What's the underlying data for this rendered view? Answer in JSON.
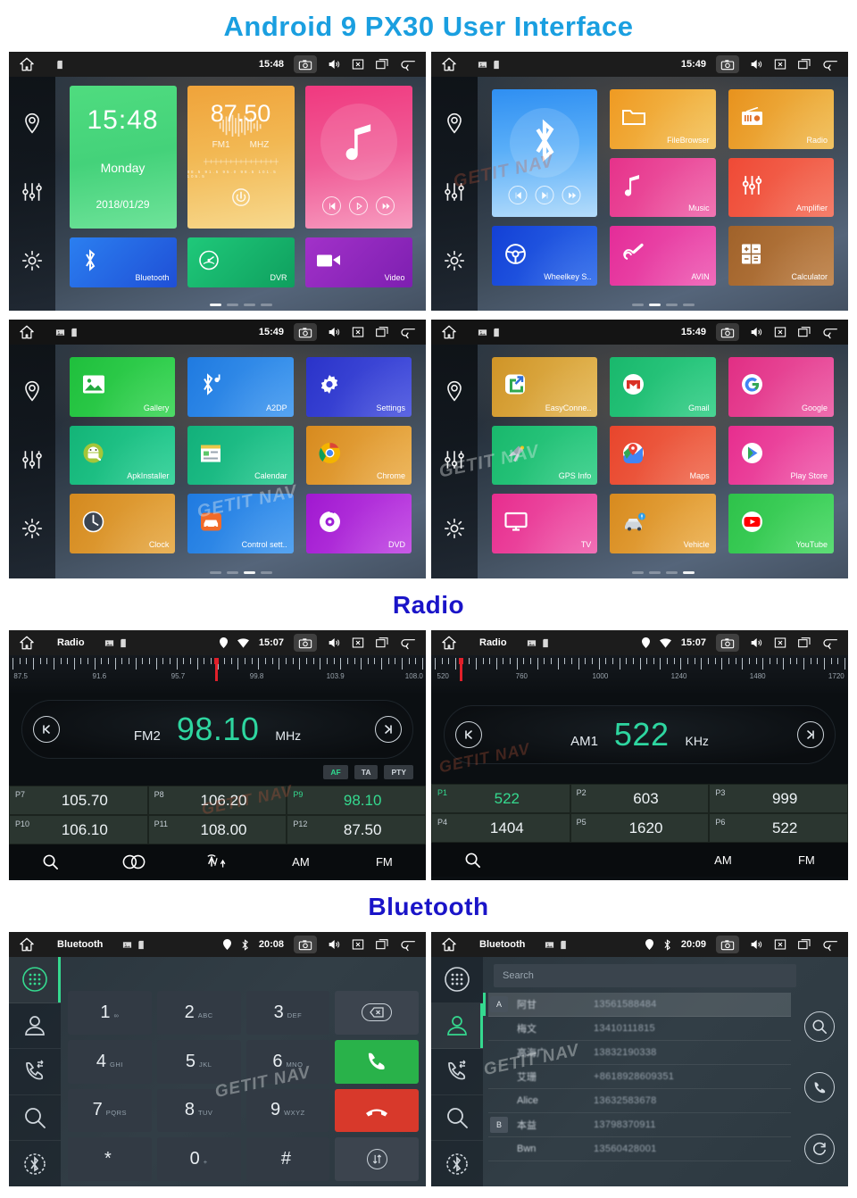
{
  "headings": {
    "main_title": "Android 9 PX30 User Interface",
    "radio": "Radio",
    "bluetooth": "Bluetooth"
  },
  "watermark": "GETIT NAV",
  "screens": {
    "home1": {
      "statusbar": {
        "time": "15:48",
        "title": ""
      },
      "clock_widget": {
        "time": "15:48",
        "day": "Monday",
        "date": "2018/01/29"
      },
      "radio_widget": {
        "freq": "87.50",
        "band": "FM1",
        "unit": "MHZ",
        "scale_ticks": "88.5  91.5  95.0  98.5  101.5  105.5"
      },
      "tiles": [
        {
          "label": "Bluetooth",
          "icon": "bluetooth-icon"
        },
        {
          "label": "DVR",
          "icon": "dvr-icon"
        },
        {
          "label": "Video",
          "icon": "video-camera-icon"
        }
      ],
      "dots": 4,
      "active_dot": 0
    },
    "home2": {
      "statusbar": {
        "time": "15:49"
      },
      "apps": [
        {
          "label": "FileBrowser",
          "icon": "folder-icon"
        },
        {
          "label": "Radio",
          "icon": "radio-icon"
        },
        {
          "label": "Music",
          "icon": "music-note-icon"
        },
        {
          "label": "Amplifier",
          "icon": "equalizer-icon"
        },
        {
          "label": "Wheelkey S..",
          "icon": "steering-wheel-icon"
        },
        {
          "label": "AVIN",
          "icon": "avin-plug-icon"
        },
        {
          "label": "Calculator",
          "icon": "calculator-icon"
        }
      ],
      "dots": 4,
      "active_dot": 1
    },
    "home3": {
      "statusbar": {
        "time": "15:49"
      },
      "apps": [
        {
          "label": "Gallery",
          "icon": "gallery-icon"
        },
        {
          "label": "A2DP",
          "icon": "bluetooth-audio-icon"
        },
        {
          "label": "Settings",
          "icon": "gear-icon"
        },
        {
          "label": "ApkInstaller",
          "icon": "android-icon"
        },
        {
          "label": "Calendar",
          "icon": "calendar-icon"
        },
        {
          "label": "Chrome",
          "icon": "chrome-icon"
        },
        {
          "label": "Clock",
          "icon": "clock-icon"
        },
        {
          "label": "Control sett..",
          "icon": "car-settings-icon"
        },
        {
          "label": "DVD",
          "icon": "dvd-disc-icon"
        }
      ],
      "dots": 4,
      "active_dot": 2
    },
    "home4": {
      "statusbar": {
        "time": "15:49"
      },
      "apps": [
        {
          "label": "EasyConne..",
          "icon": "easyconnect-icon"
        },
        {
          "label": "Gmail",
          "icon": "gmail-icon"
        },
        {
          "label": "Google",
          "icon": "google-icon"
        },
        {
          "label": "GPS Info",
          "icon": "satellite-icon"
        },
        {
          "label": "Maps",
          "icon": "maps-icon"
        },
        {
          "label": "Play Store",
          "icon": "play-store-icon"
        },
        {
          "label": "TV",
          "icon": "tv-icon"
        },
        {
          "label": "Vehicle",
          "icon": "vehicle-icon"
        },
        {
          "label": "YouTube",
          "icon": "youtube-icon"
        }
      ],
      "dots": 4,
      "active_dot": 3
    },
    "radio_fm": {
      "statusbar": {
        "title": "Radio",
        "time": "15:07"
      },
      "scale_labels": [
        "87.5",
        "91.6",
        "95.7",
        "99.8",
        "103.9",
        "108.0"
      ],
      "needle_percent": 49.5,
      "band": "FM2",
      "frequency": "98.10",
      "unit": "MHz",
      "rds": [
        {
          "label": "AF",
          "active": true
        },
        {
          "label": "TA",
          "active": false
        },
        {
          "label": "PTY",
          "active": false
        }
      ],
      "presets": [
        {
          "no": "P7",
          "value": "105.70",
          "active": false
        },
        {
          "no": "P8",
          "value": "106.20",
          "active": false
        },
        {
          "no": "P9",
          "value": "98.10",
          "active": true
        },
        {
          "no": "P10",
          "value": "106.10",
          "active": false
        },
        {
          "no": "P11",
          "value": "108.00",
          "active": false
        },
        {
          "no": "P12",
          "value": "87.50",
          "active": false
        }
      ],
      "toolbar": [
        {
          "label": "",
          "icon": "search-icon"
        },
        {
          "label": "",
          "icon": "stereo-icon"
        },
        {
          "label": "",
          "icon": "antenna-local-dx-icon"
        },
        {
          "label": "AM",
          "icon": ""
        },
        {
          "label": "FM",
          "icon": ""
        }
      ]
    },
    "radio_am": {
      "statusbar": {
        "title": "Radio",
        "time": "15:07"
      },
      "scale_labels": [
        "520",
        "760",
        "1000",
        "1240",
        "1480",
        "1720"
      ],
      "needle_percent": 6,
      "band": "AM1",
      "frequency": "522",
      "unit": "KHz",
      "presets": [
        {
          "no": "P1",
          "value": "522",
          "active": true
        },
        {
          "no": "P2",
          "value": "603",
          "active": false
        },
        {
          "no": "P3",
          "value": "999",
          "active": false
        },
        {
          "no": "P4",
          "value": "1404",
          "active": false
        },
        {
          "no": "P5",
          "value": "1620",
          "active": false
        },
        {
          "no": "P6",
          "value": "522",
          "active": false
        }
      ],
      "toolbar": [
        {
          "label": "",
          "icon": "search-icon"
        },
        {
          "label": "",
          "icon": ""
        },
        {
          "label": "",
          "icon": ""
        },
        {
          "label": "AM",
          "icon": ""
        },
        {
          "label": "FM",
          "icon": ""
        }
      ]
    },
    "bt_dialpad": {
      "statusbar": {
        "title": "Bluetooth",
        "time": "20:08"
      },
      "sidebar": [
        "dialpad-icon",
        "contacts-icon",
        "call-history-icon",
        "search-icon",
        "bluetooth-settings-icon"
      ],
      "keys": [
        {
          "digit": "1",
          "letters": "∞"
        },
        {
          "digit": "2",
          "letters": "ABC"
        },
        {
          "digit": "3",
          "letters": "DEF"
        },
        {
          "digit": "",
          "letters": "",
          "type": "backspace"
        },
        {
          "digit": "4",
          "letters": "GHI"
        },
        {
          "digit": "5",
          "letters": "JKL"
        },
        {
          "digit": "6",
          "letters": "MNO"
        },
        {
          "digit": "",
          "letters": "",
          "type": "call"
        },
        {
          "digit": "7",
          "letters": "PQRS"
        },
        {
          "digit": "8",
          "letters": "TUV"
        },
        {
          "digit": "9",
          "letters": "WXYZ"
        },
        {
          "digit": "",
          "letters": "",
          "type": "end"
        },
        {
          "digit": "*",
          "letters": ""
        },
        {
          "digit": "0",
          "letters": "+"
        },
        {
          "digit": "#",
          "letters": ""
        },
        {
          "digit": "",
          "letters": "",
          "type": "transfer"
        }
      ]
    },
    "bt_contacts": {
      "statusbar": {
        "title": "Bluetooth",
        "time": "20:09"
      },
      "search_placeholder": "Search",
      "contacts": [
        {
          "section": "A",
          "name": "阿甘",
          "number": "13561588484",
          "selected": true
        },
        {
          "section": "",
          "name": "梅文",
          "number": "13410111815",
          "selected": false
        },
        {
          "section": "",
          "name": "高海广",
          "number": "13832190338",
          "selected": false
        },
        {
          "section": "",
          "name": "艾珊",
          "number": "+8618928609351",
          "selected": false
        },
        {
          "section": "",
          "name": "Alice",
          "number": "13632583678",
          "selected": false
        },
        {
          "section": "B",
          "name": "本益",
          "number": "13798370911",
          "selected": false
        },
        {
          "section": "",
          "name": "Bwn",
          "number": "13560428001",
          "selected": false
        }
      ],
      "actions": [
        "search-icon",
        "call-icon",
        "sync-icon"
      ]
    }
  }
}
